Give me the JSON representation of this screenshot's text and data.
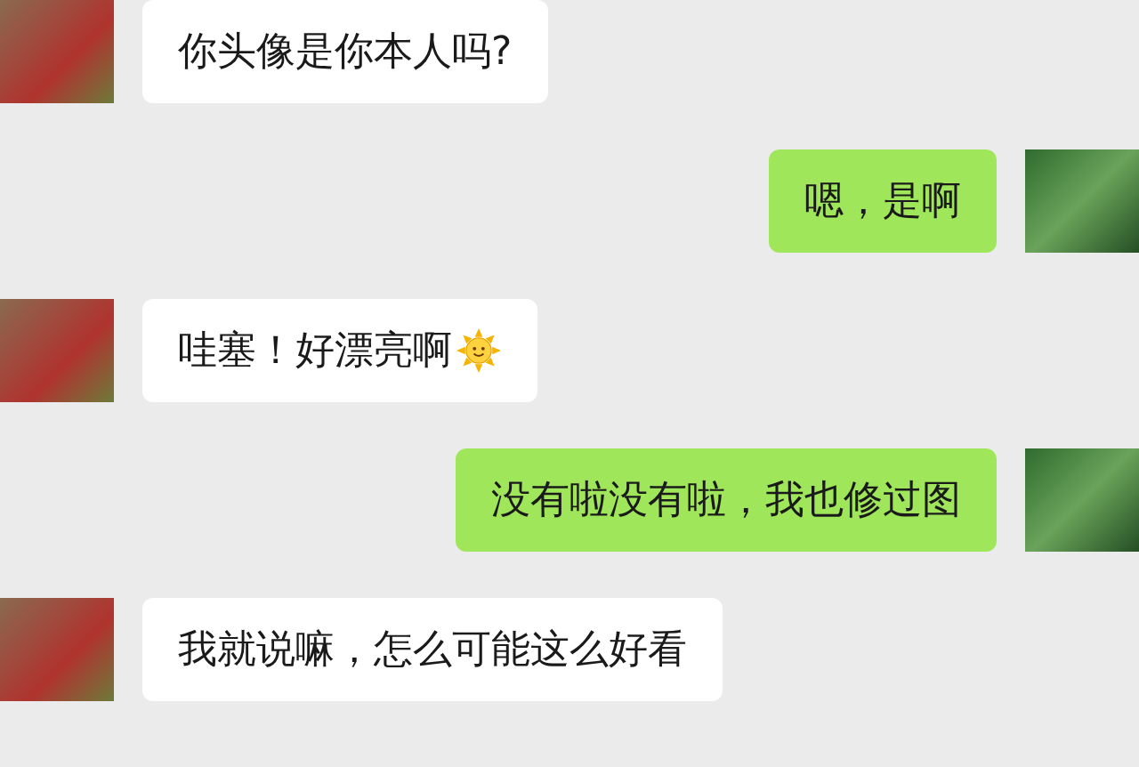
{
  "messages": [
    {
      "kind": "received",
      "text": "你头像是你本人吗?"
    },
    {
      "kind": "sent",
      "text": "嗯，是啊"
    },
    {
      "kind": "received",
      "text": "哇塞！好漂亮啊",
      "emoji": true
    },
    {
      "kind": "sent",
      "text": "没有啦没有啦，我也修过图"
    },
    {
      "kind": "received",
      "text": "我就说嘛，怎么可能这么好看"
    }
  ]
}
